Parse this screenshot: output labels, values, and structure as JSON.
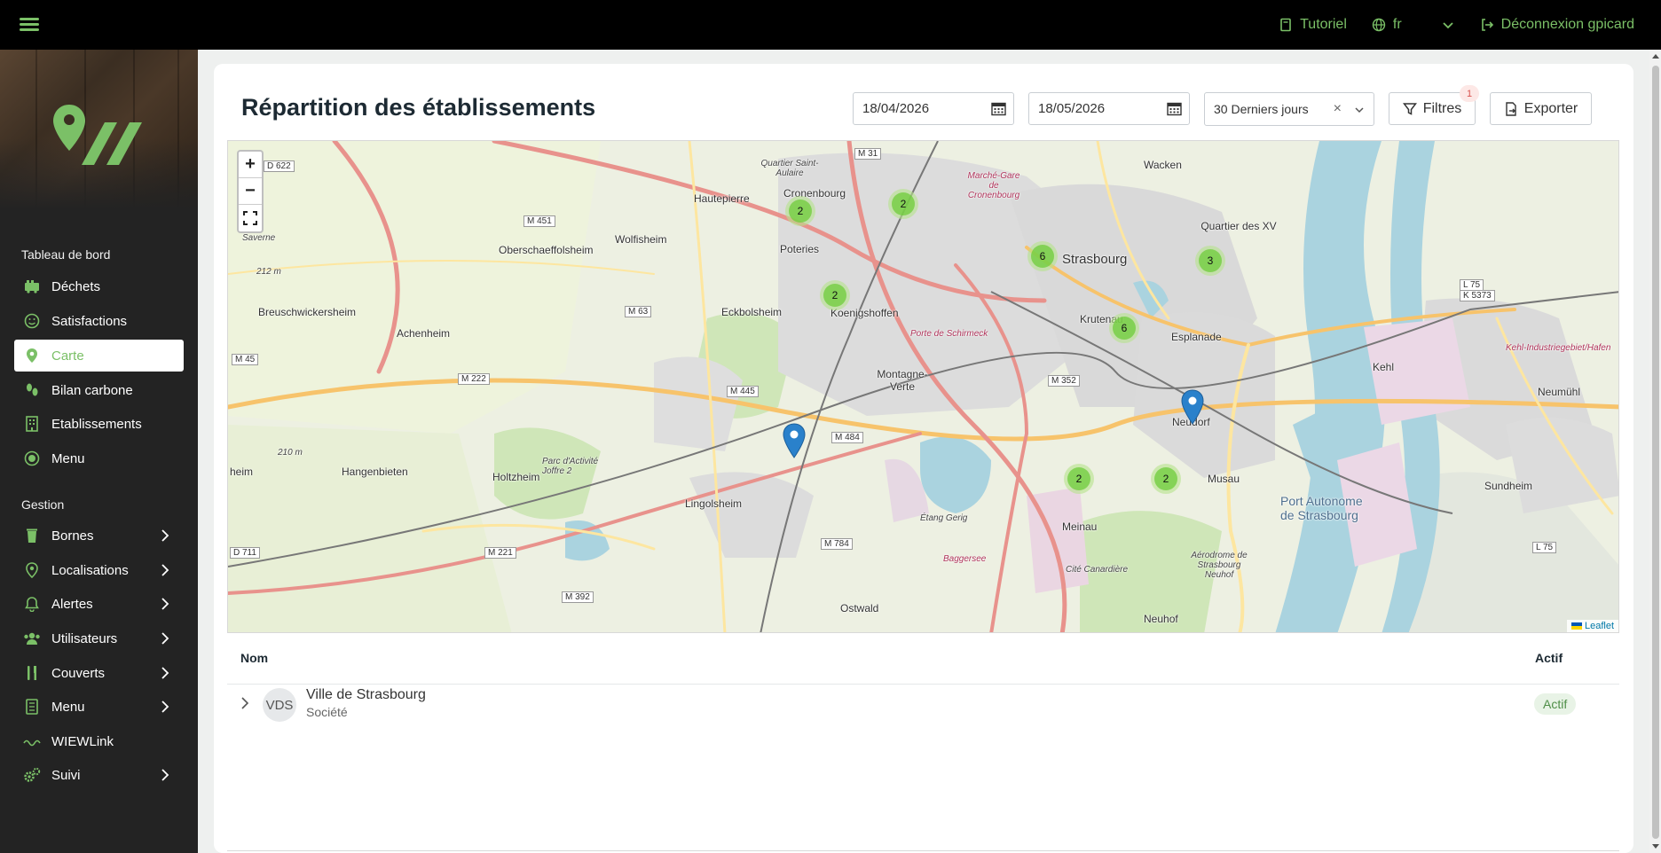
{
  "topbar": {
    "tutorial_label": "Tutoriel",
    "language": "fr",
    "logout_label": "Déconnexion gpicard",
    "accent_color": "#7bc067"
  },
  "sidebar": {
    "dashboard_section": "Tableau de bord",
    "dashboard_items": [
      {
        "label": "Déchets",
        "icon": "truck-icon"
      },
      {
        "label": "Satisfactions",
        "icon": "smile-icon"
      },
      {
        "label": "Carte",
        "icon": "map-pin-icon",
        "active": true
      },
      {
        "label": "Bilan carbone",
        "icon": "footprints-icon"
      },
      {
        "label": "Etablissements",
        "icon": "building-icon"
      },
      {
        "label": "Menu",
        "icon": "plate-icon"
      }
    ],
    "management_section": "Gestion",
    "management_items": [
      {
        "label": "Bornes",
        "icon": "trash-bin-icon"
      },
      {
        "label": "Localisations",
        "icon": "map-pin-icon"
      },
      {
        "label": "Alertes",
        "icon": "bell-icon"
      },
      {
        "label": "Utilisateurs",
        "icon": "users-icon"
      },
      {
        "label": "Couverts",
        "icon": "cutlery-icon"
      },
      {
        "label": "Menu",
        "icon": "document-icon"
      },
      {
        "label": "WIEWLink",
        "icon": "signal-icon"
      },
      {
        "label": "Suivi",
        "icon": "gears-icon"
      }
    ]
  },
  "page": {
    "title": "Répartition des établissements",
    "date_from": "18/04/2026",
    "date_to": "18/05/2026",
    "period_select": "30 Derniers jours",
    "filters_label": "Filtres",
    "filters_count": "1",
    "export_label": "Exporter"
  },
  "map": {
    "attribution": "Leaflet",
    "clusters": [
      "2",
      "2",
      "6",
      "3",
      "2",
      "6",
      "2",
      "2"
    ],
    "places": {
      "wacken": "Wacken",
      "hautepierre": "Hautepierre",
      "cronenbourg": "Cronenbourg",
      "strasbourg": "Strasbourg",
      "quartier_xv": "Quartier des XV",
      "wolfisheim": "Wolfisheim",
      "poteries": "Poteries",
      "oberschaeffolsheim": "Oberschaeffolsheim",
      "eckbolsheim": "Eckbolsheim",
      "koenigshoffen": "Koenigshoffen",
      "krutenau": "Krutenau",
      "esplanade": "Esplanade",
      "breuschwickersheim": "Breuschwickersheim",
      "achenheim": "Achenheim",
      "montagne_verte": "Montagne-Verte",
      "kehl": "Kehl",
      "neudorf": "Neudorf",
      "hangenbieten": "Hangenbieten",
      "holtzheim": "Holtzheim",
      "lingolsheim": "Lingolsheim",
      "musau": "Musau",
      "sundheim": "Sundheim",
      "port_autonome_1": "Port Autonome",
      "port_autonome_2": "de Strasbourg",
      "meinau": "Meinau",
      "ostwald": "Ostwald",
      "neuhof": "Neuhof",
      "neumuhl": "Neumühl",
      "marche_gare": "Marché-Gare de Cronenbourg",
      "porte_schirmeck": "Porte de Schirmeck",
      "cite_canardiere": "Cité Canardière",
      "baggersee": "Baggersee",
      "aerodrome": "Aérodrome de Strasbourg Neuhof",
      "parc_activite": "Parc d'Activité Joffre 2",
      "etang_gerig": "Étang Gerig",
      "saverne": "Saverne",
      "quartier_st_aulaire": "Quartier Saint-Aulaire",
      "kehl_industrie": "Kehl-Industriegebiet/Hafen",
      "m451": "M 451",
      "m63": "M 63",
      "m45": "M 45",
      "m222": "M 222",
      "m445": "M 445",
      "m484": "M 484",
      "m352": "M 352",
      "m784": "M 784",
      "m221": "M 221",
      "m392": "M 392",
      "m31": "M 31",
      "d622": "D 622",
      "d711": "D 711",
      "l75": "L 75",
      "l75b": "L 75",
      "k5373": "K 5373",
      "alt212": "212 m",
      "alt210": "210 m",
      "heim": "heim"
    }
  },
  "table": {
    "col_name": "Nom",
    "col_active": "Actif",
    "rows": [
      {
        "avatar": "VDS",
        "name": "Ville de Strasbourg",
        "type": "Société",
        "status": "Actif"
      }
    ]
  }
}
